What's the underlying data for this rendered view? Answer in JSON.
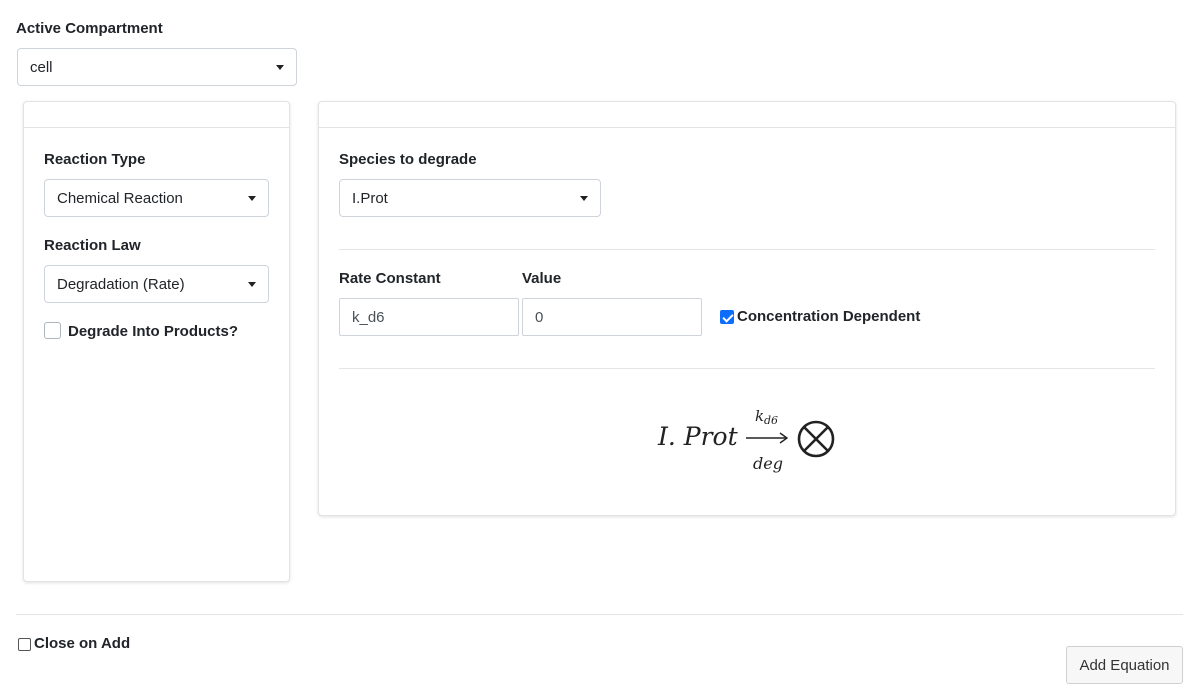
{
  "compartment": {
    "label": "Active Compartment",
    "selected": "cell"
  },
  "left_panel": {
    "reaction_type_label": "Reaction Type",
    "reaction_type_selected": "Chemical Reaction",
    "reaction_law_label": "Reaction Law",
    "reaction_law_selected": "Degradation (Rate)",
    "degrade_into_products_label": "Degrade Into Products?",
    "degrade_into_products_checked": false
  },
  "right_panel": {
    "species_label": "Species to degrade",
    "species_selected": "I.Prot",
    "rate_constant_label": "Rate Constant",
    "rate_constant_value": "k_d6",
    "value_label": "Value",
    "value_value": "0",
    "concentration_dependent_label": "Concentration Dependent",
    "concentration_dependent_checked": true,
    "equation": {
      "reactant": "I. Prot",
      "rate_symbol": "k",
      "rate_subscript": "d6",
      "under_arrow": "deg",
      "product_symbol": "⊗"
    }
  },
  "footer": {
    "close_on_add_label": "Close on Add",
    "close_on_add_checked": false,
    "add_button_label": "Add Equation"
  }
}
